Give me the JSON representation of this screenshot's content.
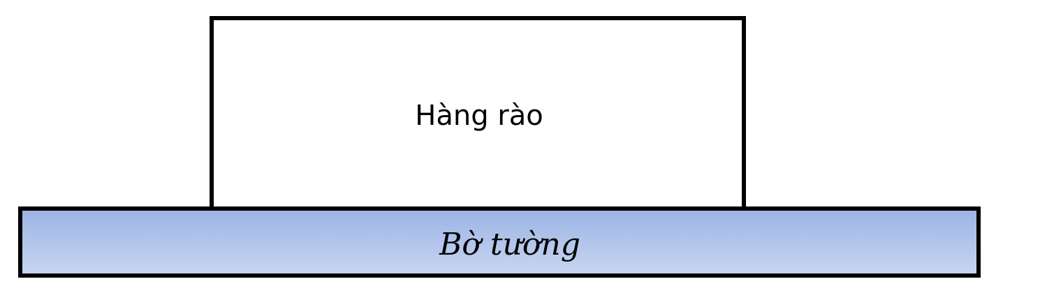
{
  "diagram": {
    "fence": {
      "label": "Hàng rào",
      "fill": "#ffffff",
      "border": "#000000"
    },
    "wall": {
      "label": "Bờ tường",
      "fill_top": "#9cb4e4",
      "fill_bottom": "#c7d5f1",
      "border": "#000000"
    }
  }
}
